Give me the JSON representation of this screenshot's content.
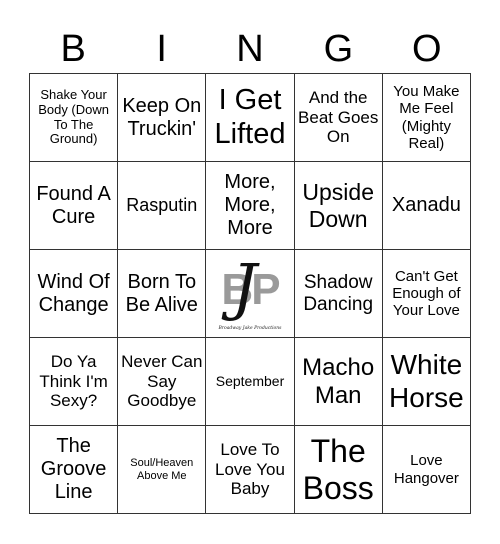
{
  "header": {
    "letters": [
      "B",
      "I",
      "N",
      "G",
      "O"
    ]
  },
  "cells": [
    "Shake Your Body (Down To The Ground)",
    "Keep On Truckin'",
    "I Get Lifted",
    "And the Beat Goes On",
    "You Make Me Feel (Mighty Real)",
    "Found A Cure",
    "Rasputin",
    "More, More, More",
    "Upside Down",
    "Xanadu",
    "Wind Of Change",
    "Born To Be Alive",
    "",
    "Shadow Dancing",
    "Can't Get Enough of Your Love",
    "Do Ya Think I'm Sexy?",
    "Never Can Say Goodbye",
    "September",
    "Macho Man",
    "White Horse",
    "The Groove Line",
    "Soul/Heaven Above Me",
    "Love To Love You Baby",
    "The Boss",
    "Love Hangover"
  ],
  "free_space": {
    "logo_letters": "BP",
    "logo_initial": "J",
    "logo_caption": "Broadway Jake Productions",
    "icon": "company-logo"
  }
}
